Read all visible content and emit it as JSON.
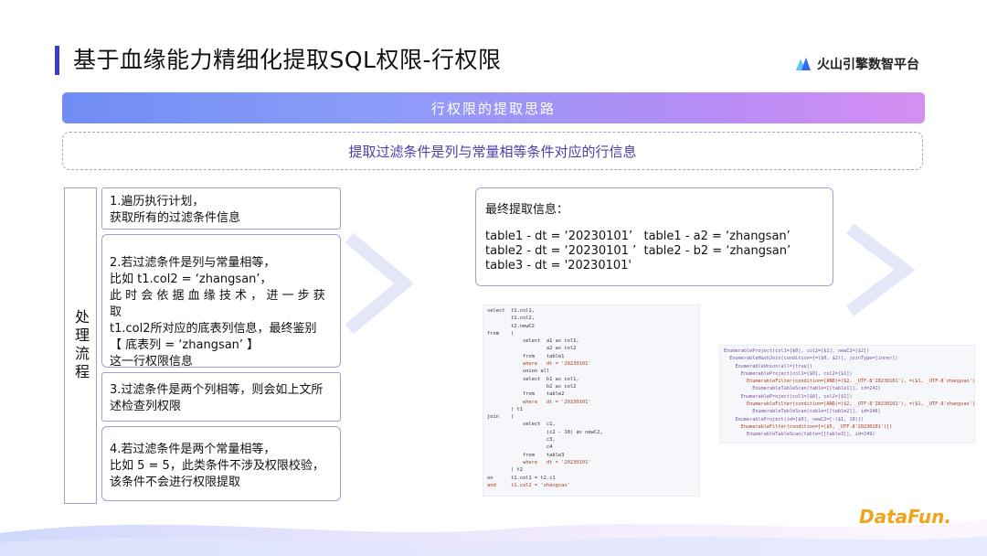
{
  "header": {
    "title": "基于血缘能力精细化提取SQL权限-行权限",
    "brand": "火山引擎数智平台"
  },
  "banner": "行权限的提取思路",
  "subtitle": "提取过滤条件是列与常量相等条件对应的行信息",
  "process": {
    "label": "处理流程",
    "steps": [
      "1.遍历执行计划，\n获取所有的过滤条件信息",
      "2.若过滤条件是列与常量相等，\n比如 t1.col2 = ‘zhangsan’，\n此 时 会 依 据 血 缘 技 术 ， 进 一 步 获 取\nt1.col2所对应的底表列信息，最终鉴别\n【 底表列 = ‘zhangsan’ 】\n这一行权限信息",
      "3.过滤条件是两个列相等，则会如上文所\n述检查列权限",
      "4.若过滤条件是两个常量相等，\n比如 5 = 5，此类条件不涉及权限校验，\n该条件不会进行权限提取"
    ]
  },
  "final": {
    "title": "最终提取信息：",
    "lines": [
      "table1 - dt = ‘20230101’   table1 - a2 = ‘zhangsan’",
      "table2 - dt = ‘20230101 ’  table2 - b2 = ‘zhangsan’",
      "table3 - dt = '20230101'"
    ]
  },
  "code_sql": [
    "select  t1.col1,",
    "        t1.col2,",
    "        t2.newC2",
    "from    (",
    "            select  a1 as col1,",
    "                    a2 as col2",
    "            from    table1",
    "            where   dt = '20230101'",
    "            union all",
    "            select  b1 as col1,",
    "                    b2 as col2",
    "            from    table2",
    "            where   dt = '20230101'",
    "        ) t1",
    "join    (",
    "            select  c1,",
    "                    (c2 - 10) as newC2,",
    "                    c3,",
    "                    c4",
    "            from    table3",
    "            where   dt = '20230101'",
    "        ) t2",
    "on      t1.col1 = t2.c1",
    "and     t1.col2 = 'zhangsan'"
  ],
  "code_plan": [
    "EnumerableProject(col1=[$0], col2=[$1], newC2=[$2])",
    "  EnumerableHashJoin(condition=[=($0, $2)], joinType=[inner])",
    "    EnumerableUnion(all=[true])",
    "      EnumerableProject(col1=[$0], col2=[$1])",
    "        EnumerableFilter(condition=[AND(=($2, _UTF-8'20230101'), =($1, _UTF-8'zhangsan'))])",
    "          EnumerableTableScan(table=[[table1]], id=242)",
    "      EnumerableProject(col1=[$0], col2=[$1])",
    "        EnumerableFilter(condition=[AND(=($2, _UTF-8'20230101'), =($1, _UTF-8'zhangsan'))])",
    "          EnumerableTableScan(table=[[table2]], id=246)",
    "    EnumerableProject(id=[$0], newC2=[-($1, 10)])",
    "      EnumerableFilter(condition=[=($5, _UTF-8'20230101')])",
    "        EnumerableTableScan(table=[[table3]], id=249)"
  ],
  "footer_logo": "DataFun."
}
